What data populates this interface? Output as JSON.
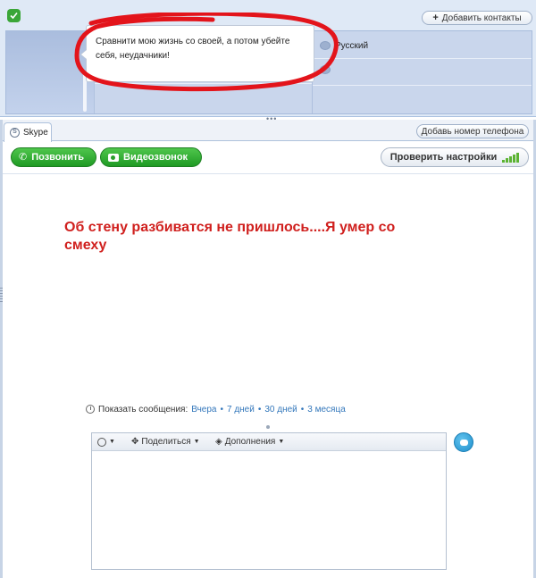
{
  "header": {
    "add_contacts_label": "Добавить контакты"
  },
  "profile": {
    "mood_message": "Сравнити мою жизнь со своей, а потом убейте себя, неудачники!",
    "language": "Русский"
  },
  "tabs": [
    {
      "label": "Skype"
    }
  ],
  "add_phone_label": "Добавь номер телефона",
  "toolbar": {
    "call_label": "Позвонить",
    "video_label": "Видеозвонок",
    "check_settings_label": "Проверить настройки"
  },
  "caption": "Об стену разбиватся не пришлось....Я умер со смеху",
  "history": {
    "label": "Показать сообщения:",
    "links": [
      "Вчера",
      "7 дней",
      "30 дней",
      "3 месяца"
    ],
    "separator": "•"
  },
  "compose": {
    "share_label": "Поделиться",
    "extras_label": "Дополнения",
    "message_value": ""
  },
  "icons": {
    "status": "skype-online-icon",
    "phone": "phone-icon",
    "video": "camera-icon",
    "signal": "signal-bars-icon",
    "clock": "clock-icon",
    "emoticon": "smiley-icon",
    "share": "share-icon",
    "extras": "extras-icon",
    "send": "chat-bubble-icon"
  },
  "colors": {
    "accent_green": "#2aa22e",
    "caption_red": "#d0201e",
    "link_blue": "#3377bb",
    "strip_blue": "#b7c8e6"
  }
}
